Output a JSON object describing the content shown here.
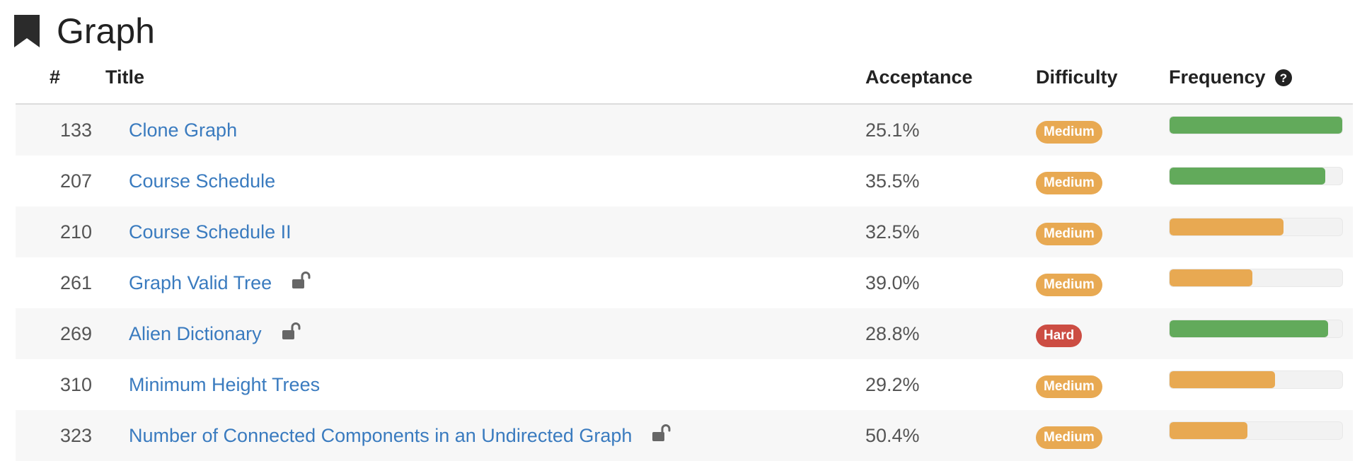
{
  "page": {
    "title": "Graph",
    "icon": "bookmark-icon"
  },
  "table": {
    "columns": {
      "number": "#",
      "title": "Title",
      "acceptance": "Acceptance",
      "difficulty": "Difficulty",
      "frequency": "Frequency"
    },
    "frequency_help_icon": "question-circle-icon",
    "rows": [
      {
        "number": "133",
        "title": "Clone Graph",
        "locked": false,
        "acceptance": "25.1%",
        "difficulty": "Medium",
        "frequency": 1.0,
        "frequency_level": "high"
      },
      {
        "number": "207",
        "title": "Course Schedule",
        "locked": false,
        "acceptance": "35.5%",
        "difficulty": "Medium",
        "frequency": 0.9,
        "frequency_level": "high"
      },
      {
        "number": "210",
        "title": "Course Schedule II",
        "locked": false,
        "acceptance": "32.5%",
        "difficulty": "Medium",
        "frequency": 0.66,
        "frequency_level": "mid"
      },
      {
        "number": "261",
        "title": "Graph Valid Tree",
        "locked": true,
        "acceptance": "39.0%",
        "difficulty": "Medium",
        "frequency": 0.48,
        "frequency_level": "mid"
      },
      {
        "number": "269",
        "title": "Alien Dictionary",
        "locked": true,
        "acceptance": "28.8%",
        "difficulty": "Hard",
        "frequency": 0.92,
        "frequency_level": "high"
      },
      {
        "number": "310",
        "title": "Minimum Height Trees",
        "locked": false,
        "acceptance": "29.2%",
        "difficulty": "Medium",
        "frequency": 0.61,
        "frequency_level": "mid"
      },
      {
        "number": "323",
        "title": "Number of Connected Components in an Undirected Graph",
        "locked": true,
        "acceptance": "50.4%",
        "difficulty": "Medium",
        "frequency": 0.45,
        "frequency_level": "mid"
      }
    ]
  },
  "colors": {
    "link": "#3a7bbf",
    "medium": "#e8a952",
    "hard": "#cc4d43",
    "frequency_high": "#62aa5b",
    "frequency_mid": "#e8a952",
    "row_alt": "#f7f7f7"
  }
}
